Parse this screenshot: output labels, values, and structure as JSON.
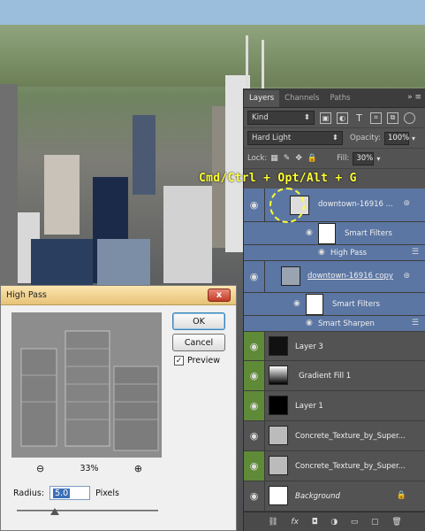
{
  "layers_panel": {
    "tabs": [
      "Layers",
      "Channels",
      "Paths"
    ],
    "panel_controls": "»  ≡",
    "filter_kind": "Kind",
    "blend_mode": "Hard Light",
    "opacity_label": "Opacity:",
    "opacity_value": "100%",
    "lock_label": "Lock:",
    "fill_label": "Fill:",
    "fill_value": "30%",
    "layers": [
      {
        "name": "downtown-16916 ..."
      },
      {
        "name": "Smart Filters"
      },
      {
        "name": "High Pass"
      },
      {
        "name": "downtown-16916 copy"
      },
      {
        "name": "Smart Filters"
      },
      {
        "name": "Smart Sharpen"
      },
      {
        "name": "Layer 3"
      },
      {
        "name": "Gradient Fill 1"
      },
      {
        "name": "Layer 1"
      },
      {
        "name": "Concrete_Texture_by_Super..."
      },
      {
        "name": "Concrete_Texture_by_Super..."
      },
      {
        "name": "Background"
      }
    ],
    "bottom_icons": [
      "link-icon",
      "fx-icon",
      "mask-icon",
      "adjustment-icon",
      "folder-icon",
      "new-layer-icon",
      "trash-icon"
    ]
  },
  "overlay": {
    "shortcut_text": "Cmd/Ctrl + Opt/Alt + G"
  },
  "dialog": {
    "title": "High Pass",
    "close_label": "x",
    "ok_label": "OK",
    "cancel_label": "Cancel",
    "preview_label": "Preview",
    "preview_checked": true,
    "zoom_value": "33%",
    "radius_label": "Radius:",
    "radius_value": "5.0",
    "radius_unit": "Pixels"
  },
  "colors": {
    "selected_layer": "#5b76a3",
    "green_eye": "#5f8a37",
    "shortcut": "#ffff33"
  }
}
